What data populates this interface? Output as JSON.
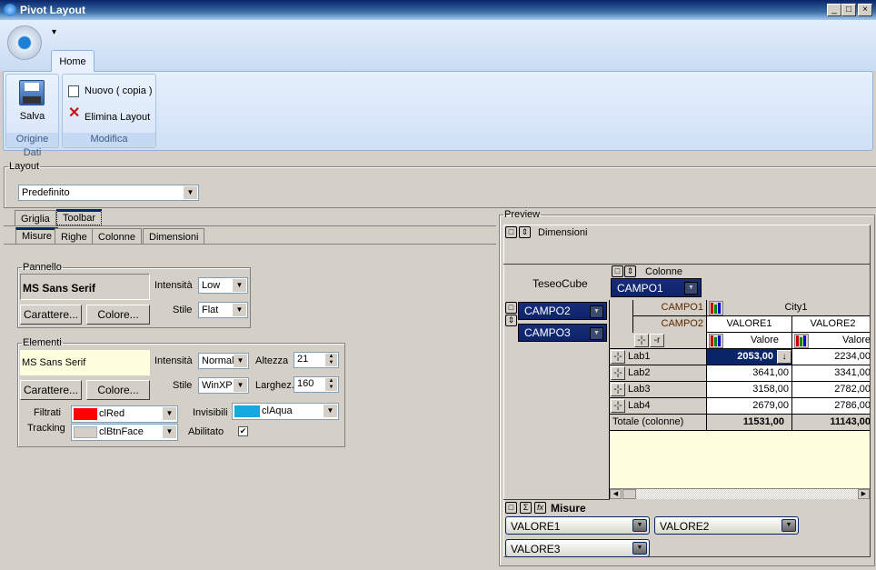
{
  "window": {
    "title": "Pivot Layout",
    "controls": [
      "_",
      "□",
      "×"
    ]
  },
  "ribbon": {
    "qa_arrow": "▾",
    "tab": "Home",
    "groups": [
      {
        "label": "Origine Dati",
        "buttons": [
          {
            "label": "Salva",
            "icon": "floppy-disk-icon"
          }
        ]
      },
      {
        "label": "Modifica",
        "buttons": [
          {
            "label": "Nuovo ( copia )",
            "icon": "copy-icon"
          },
          {
            "label": "Elimina Layout",
            "icon": "red-x-icon"
          }
        ]
      }
    ]
  },
  "layout": {
    "legend": "Layout",
    "selected": "Predefinito"
  },
  "tabs": {
    "top": [
      "Griglia",
      "Toolbar"
    ],
    "top_selected": "Toolbar",
    "sub": [
      "Misure",
      "Righe",
      "Colonne",
      "Dimensioni"
    ],
    "sub_selected": "Misure"
  },
  "pannello": {
    "legend": "Pannello",
    "font_sample": "MS Sans Serif",
    "btn_font": "Carattere...",
    "btn_color": "Colore...",
    "intensita_label": "Intensità",
    "intensita": "Low",
    "stile_label": "Stile",
    "stile": "Flat"
  },
  "elementi": {
    "legend": "Elementi",
    "font_sample": "MS Sans Serif",
    "btn_font": "Carattere...",
    "btn_color": "Colore...",
    "intensita_label": "Intensità",
    "intensita": "Normal",
    "stile_label": "Stile",
    "stile": "WinXP",
    "altezza_label": "Altezza",
    "altezza": "21",
    "larghezza_label": "Larghez.",
    "larghezza": "160",
    "filtrati_label": "Filtrati",
    "filtrati": "clRed",
    "filtrati_color": "#ff0000",
    "tracking_label": "Tracking",
    "tracking": "clBtnFace",
    "tracking_color": "#d4d0c8",
    "invisibili_label": "Invisibili",
    "invisibili": "clAqua",
    "invisibili_color": "#16a8e0",
    "abilitato_label": "Abilitato",
    "abilitato": true
  },
  "preview": {
    "legend": "Preview",
    "dimensioni": "Dimensioni",
    "cube": "TeseoCube",
    "colonne": "Colonne",
    "col_field": "CAMPO1",
    "row_fields": [
      "CAMPO2",
      "CAMPO3"
    ],
    "grid": {
      "col_field": "CAMPO1",
      "col_value": "City1",
      "row_field": "CAMPO2",
      "measures": [
        "VALORE1",
        "VALORE2"
      ],
      "sub": "Valore",
      "rows": [
        {
          "label": "Lab1",
          "values": [
            "2053,00",
            "2234,00"
          ]
        },
        {
          "label": "Lab2",
          "values": [
            "3641,00",
            "3341,00"
          ]
        },
        {
          "label": "Lab3",
          "values": [
            "3158,00",
            "2782,00"
          ]
        },
        {
          "label": "Lab4",
          "values": [
            "2679,00",
            "2786,00"
          ]
        }
      ],
      "total_label": "Totale (colonne)",
      "totals": [
        "11531,00",
        "11143,00"
      ]
    },
    "misure": "Misure",
    "measure_fields": [
      "VALORE1",
      "VALORE2",
      "VALORE3"
    ]
  },
  "colors": {
    "selection": "#0a246a",
    "empty_area": "#ffffe0"
  }
}
